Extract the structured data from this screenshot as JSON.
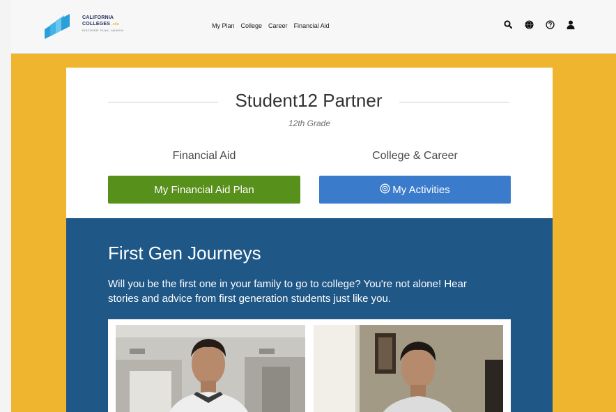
{
  "logo": {
    "line1": "CALIFORNIA",
    "line2": "COLLEGES",
    "suffix": ".edu",
    "tagline": "DISCOVER. PLAN. LAUNCH."
  },
  "nav": {
    "items": [
      "My Plan",
      "College",
      "Career",
      "Financial Aid"
    ]
  },
  "header_icons": [
    "search-icon",
    "globe-icon",
    "help-icon",
    "user-icon"
  ],
  "profile": {
    "name": "Student12 Partner",
    "grade": "12th Grade"
  },
  "columns": {
    "financial_aid": {
      "label": "Financial Aid",
      "button": "My Financial Aid Plan"
    },
    "college_career": {
      "label": "College & Career",
      "button": "My Activities"
    }
  },
  "journey": {
    "title": "First Gen Journeys",
    "description": "Will you be the first one in your family to go to college? You're not alone! Hear stories and advice from first generation students just like you."
  },
  "colors": {
    "page_background": "#f0b52f",
    "green_button": "#57901a",
    "blue_button": "#3b7bcb",
    "journey_section": "#1f5787"
  }
}
